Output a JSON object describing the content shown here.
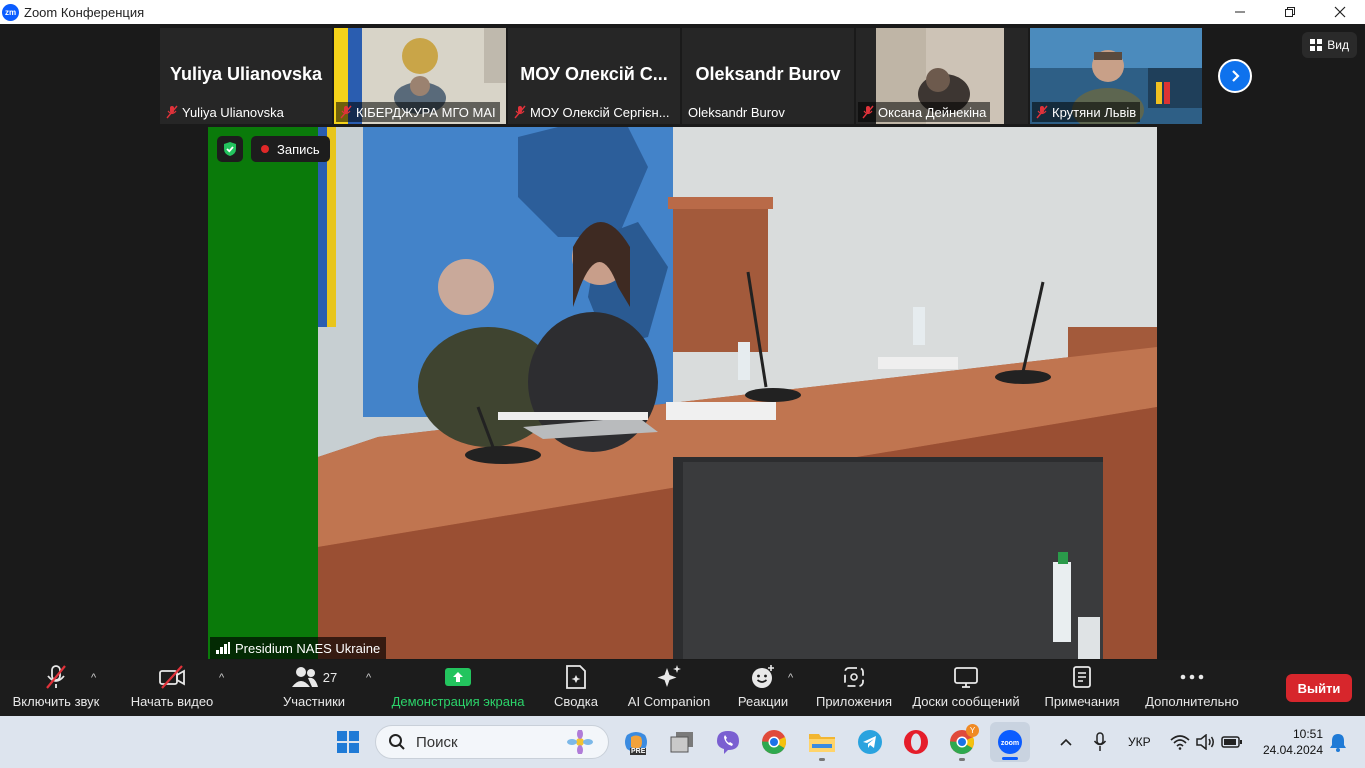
{
  "window": {
    "app_logo_text": "zm",
    "title": "Zoom Конференция",
    "controls": {
      "minimize_icon": "minimize-icon",
      "restore_icon": "restore-icon",
      "close_icon": "close-icon"
    }
  },
  "gallery": {
    "tiles": [
      {
        "big_name": "Yuliya Ulianovska",
        "label": "Yuliya Ulianovska",
        "muted": true,
        "has_video": false
      },
      {
        "big_name": "",
        "label": "КІБЕРДЖУРА МГО МАІ",
        "muted": true,
        "has_video": true
      },
      {
        "big_name": "МОУ  Олексій С...",
        "label": "МОУ Олексій Сергієн...",
        "muted": true,
        "has_video": false
      },
      {
        "big_name": "Oleksandr Burov",
        "label": "Oleksandr Burov",
        "muted": false,
        "has_video": false
      },
      {
        "big_name": "",
        "label": "Оксана Дейнекіна",
        "muted": true,
        "has_video": true
      },
      {
        "big_name": "",
        "label": "Крутяни Львів",
        "muted": true,
        "has_video": true
      }
    ],
    "next_icon": "chevron-right-icon",
    "view_label": "Вид",
    "view_icon": "grid-view-icon"
  },
  "stage": {
    "recording_label": "Запись",
    "speaker_name": "Presidium NAES Ukraine",
    "security_icon": "shield-check-icon",
    "signal_icon": "signal-bars-icon"
  },
  "toolbar": {
    "unmute_label": "Включить звук",
    "start_video_label": "Начать видео",
    "participants_label": "Участники",
    "participants_count": "27",
    "share_label": "Демонстрация экрана",
    "summary_label": "Сводка",
    "ai_label": "AI Companion",
    "reactions_label": "Реакции",
    "apps_label": "Приложения",
    "whiteboards_label": "Доски сообщений",
    "notes_label": "Примечания",
    "more_label": "Дополнительно",
    "leave_label": "Выйти"
  },
  "taskbar": {
    "search_placeholder": "Поиск",
    "language": "УКР",
    "time": "10:51",
    "date": "24.04.2024",
    "copilot_badge": "PRE",
    "chrome_badge": "Y"
  },
  "colors": {
    "accent_blue": "#0e72ed",
    "share_green": "#2bd46a",
    "leave_red": "#d7262c",
    "mute_red": "#e0323a",
    "stage_green": "#0a7a0a"
  }
}
